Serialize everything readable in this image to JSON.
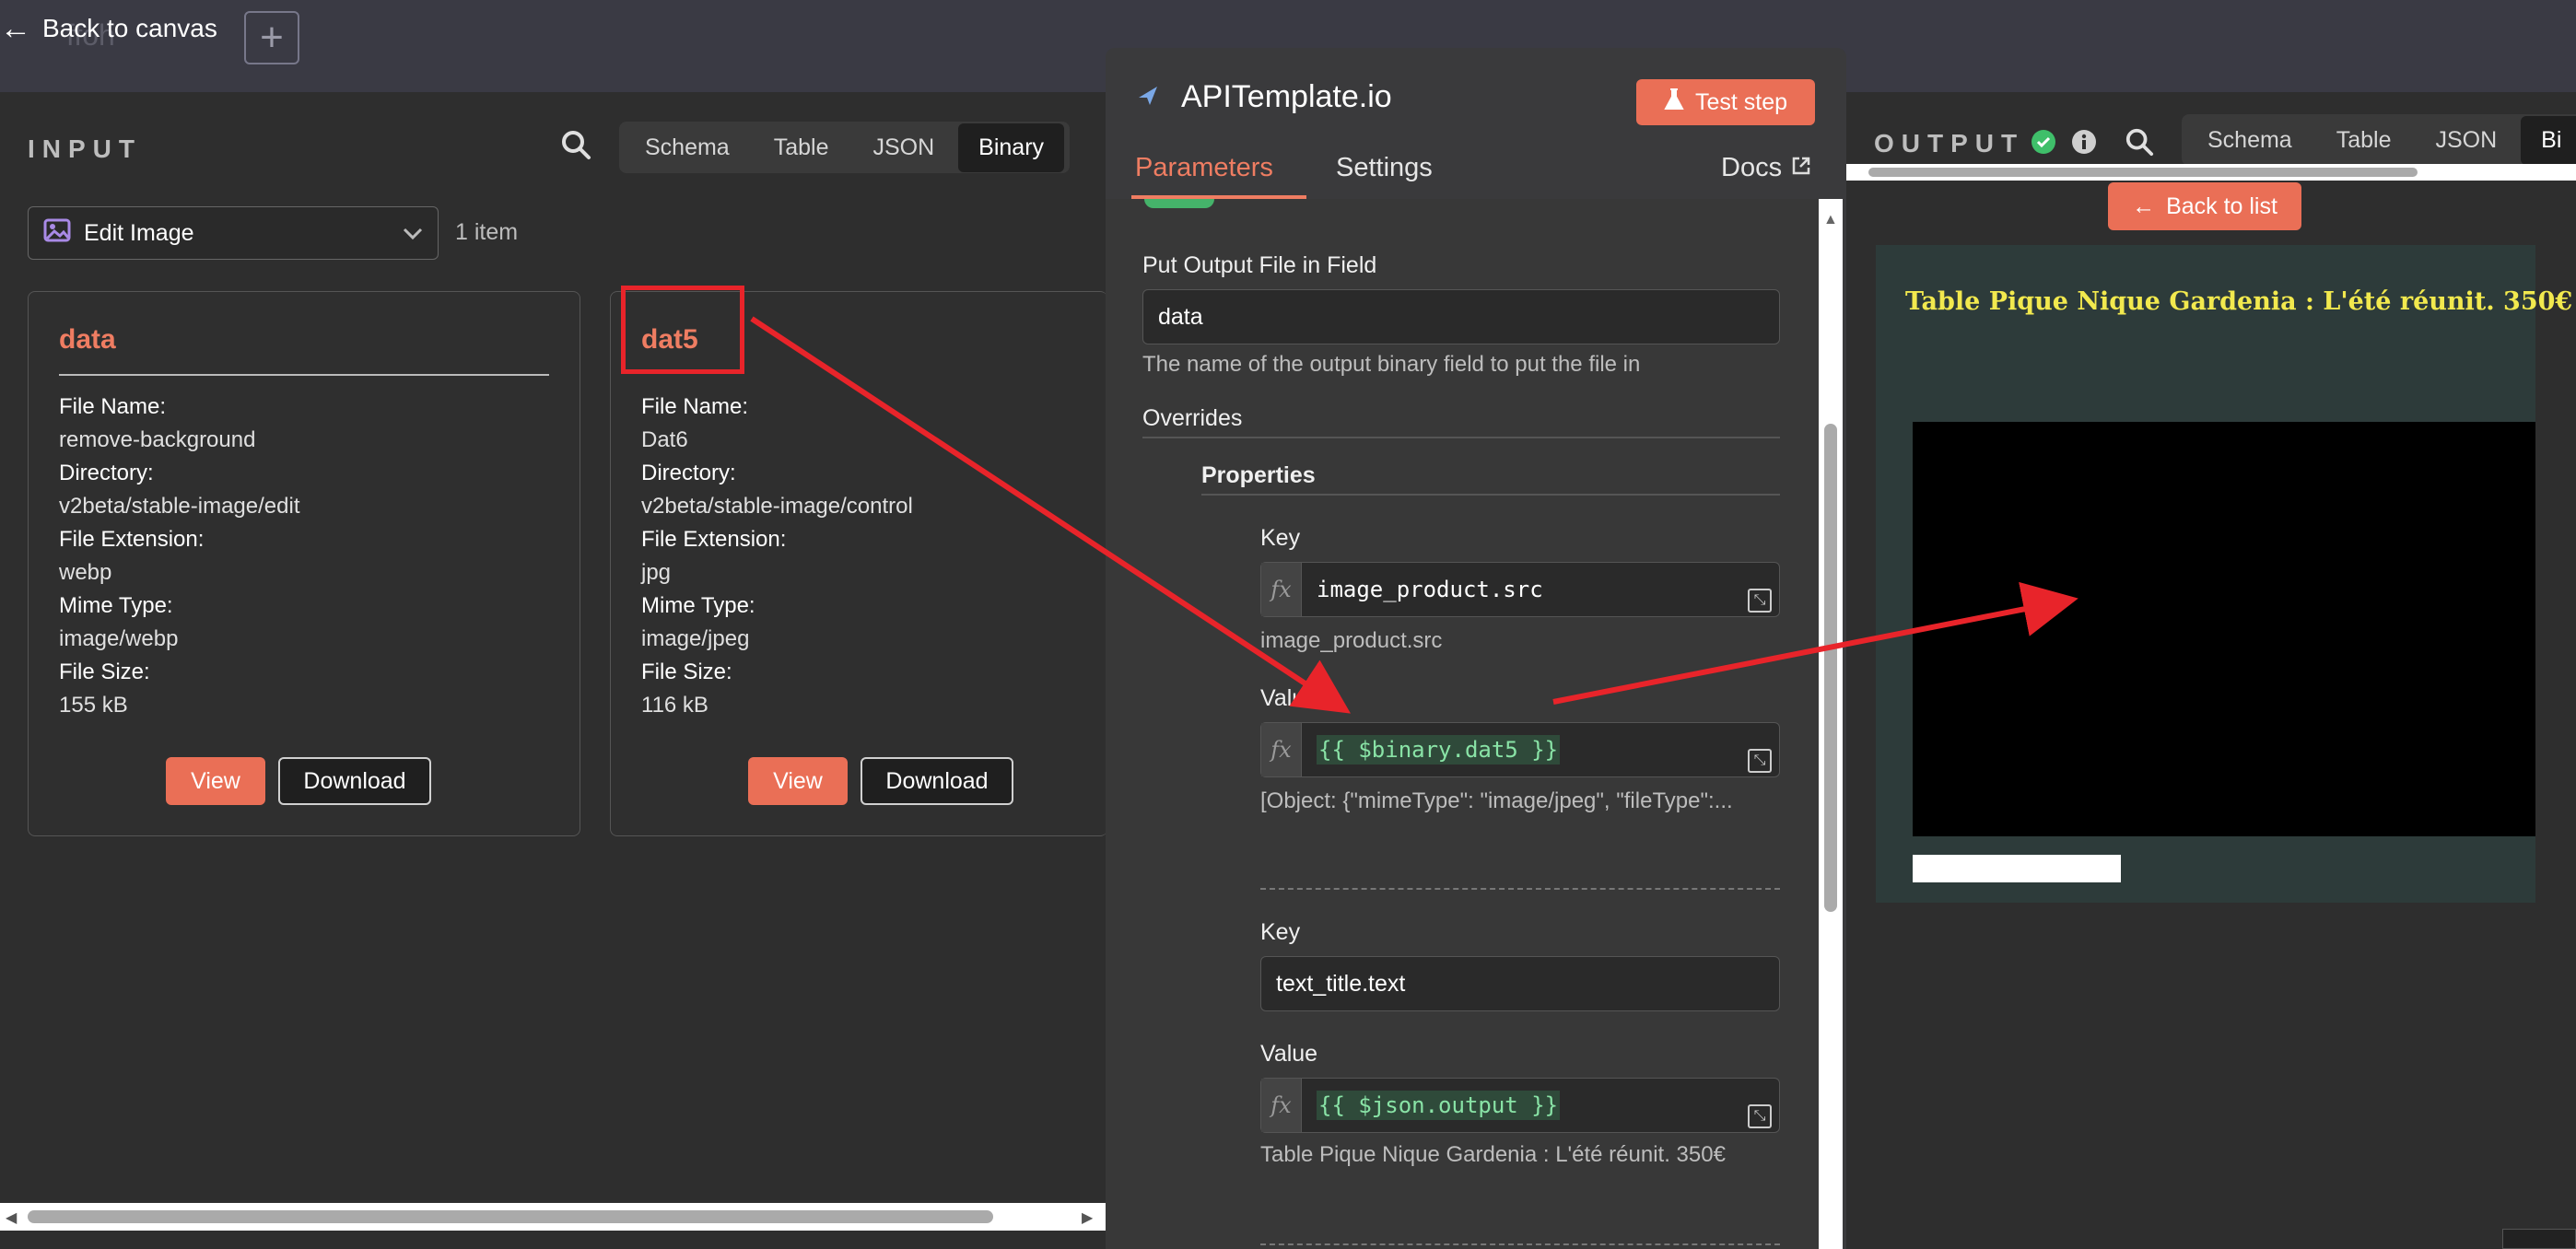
{
  "topbar": {
    "back_label": "Back to canvas",
    "ghost_title": "ffoh"
  },
  "input": {
    "label": "INPUT",
    "tabs": [
      "Schema",
      "Table",
      "JSON",
      "Binary"
    ],
    "active_tab": "Binary",
    "node_select": "Edit Image",
    "item_count": "1 item",
    "cards": [
      {
        "title": "data",
        "fields": [
          {
            "k": "File Name:",
            "v": "remove-background"
          },
          {
            "k": "Directory:",
            "v": "v2beta/stable-image/edit"
          },
          {
            "k": "File Extension:",
            "v": "webp"
          },
          {
            "k": "Mime Type:",
            "v": "image/webp"
          },
          {
            "k": "File Size:",
            "v": "155 kB"
          }
        ],
        "view": "View",
        "download": "Download"
      },
      {
        "title": "dat5",
        "fields": [
          {
            "k": "File Name:",
            "v": "Dat6"
          },
          {
            "k": "Directory:",
            "v": "v2beta/stable-image/control"
          },
          {
            "k": "File Extension:",
            "v": "jpg"
          },
          {
            "k": "Mime Type:",
            "v": "image/jpeg"
          },
          {
            "k": "File Size:",
            "v": "116 kB"
          }
        ],
        "view": "View",
        "download": "Download"
      }
    ]
  },
  "params": {
    "node_title": "APITemplate.io",
    "test_step": "Test step",
    "tabs": {
      "parameters": "Parameters",
      "settings": "Settings",
      "docs": "Docs"
    },
    "output_field_label": "Put Output File in Field",
    "output_field_value": "data",
    "output_field_hint": "The name of the output binary field to put the file in",
    "overrides_label": "Overrides",
    "properties_label": "Properties",
    "key_label": "Key",
    "value_label": "Value",
    "prop1": {
      "key": "image_product.src",
      "key_hint": "image_product.src",
      "value": "{{ $binary.dat5 }}",
      "value_hint": "[Object: {\"mimeType\": \"image/jpeg\", \"fileType\":..."
    },
    "prop2": {
      "key": "text_title.text",
      "value": "{{ $json.output }}",
      "value_hint": "Table Pique Nique Gardenia : L'été réunit. 350€"
    }
  },
  "output": {
    "label": "OUTPUT",
    "tabs": [
      "Schema",
      "Table",
      "JSON",
      "Bi"
    ],
    "back_to_list": "Back to list",
    "preview_title": "Table Pique Nique Gardenia : L'été réunit. 350€"
  },
  "colors": {
    "accent": "#ea6f56",
    "success": "#3fbf6a",
    "annotation_red": "#e8242a"
  },
  "icons": [
    "arrow-left-icon",
    "plus-icon",
    "search-icon",
    "image-icon",
    "chevron-down-icon",
    "send-icon",
    "flask-icon",
    "external-link-icon",
    "fx-icon",
    "expand-icon",
    "check-circle-icon",
    "info-icon"
  ]
}
